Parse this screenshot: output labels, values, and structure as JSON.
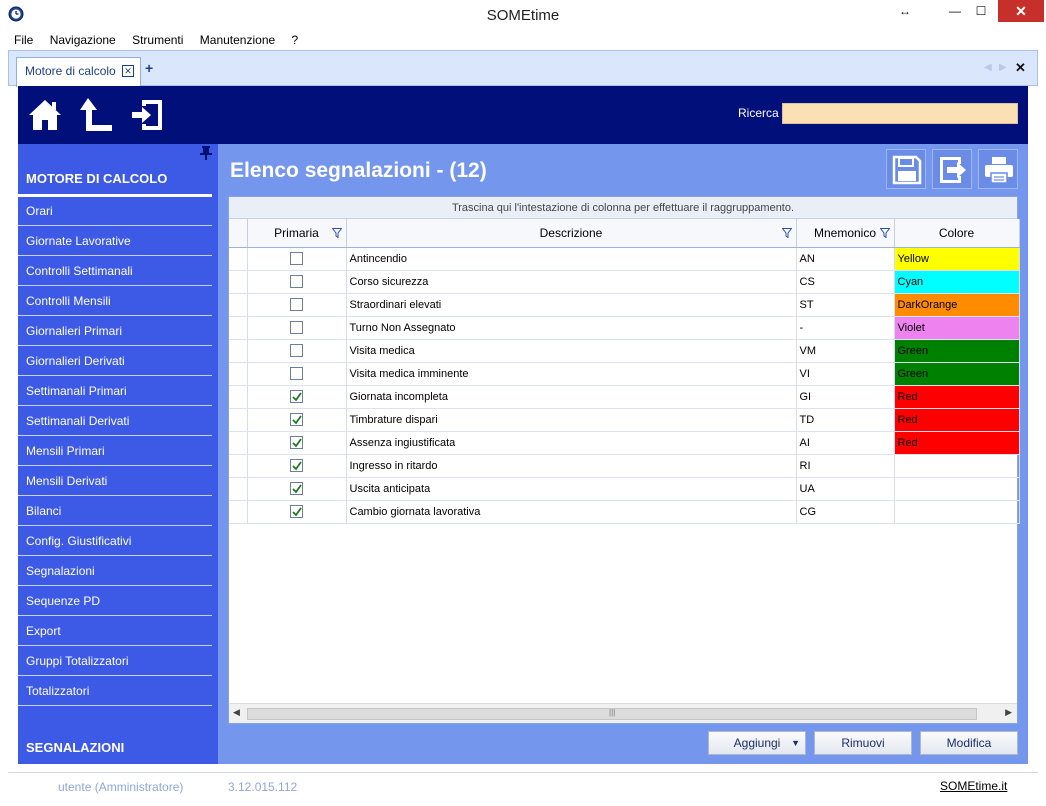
{
  "window": {
    "title": "SOMEtime"
  },
  "menu": [
    "File",
    "Navigazione",
    "Strumenti",
    "Manutenzione",
    "?"
  ],
  "tab": {
    "label": "Motore di calcolo",
    "add": "+"
  },
  "header": {
    "search_label": "Ricerca",
    "search_value": "",
    "bg_color": "#010f7b",
    "search_bg_color": "#fbe0b6"
  },
  "sidebar": {
    "title": "MOTORE DI CALCOLO",
    "items": [
      {
        "label": "Orari"
      },
      {
        "label": "Giornate Lavorative"
      },
      {
        "label": "Controlli Settimanali"
      },
      {
        "label": "Controlli Mensili"
      },
      {
        "label": "Giornalieri Primari"
      },
      {
        "label": "Giornalieri Derivati"
      },
      {
        "label": "Settimanali Primari"
      },
      {
        "label": "Settimanali Derivati"
      },
      {
        "label": "Mensili Primari"
      },
      {
        "label": "Mensili Derivati"
      },
      {
        "label": "Bilanci"
      },
      {
        "label": "Config. Giustificativi"
      },
      {
        "label": "Segnalazioni"
      },
      {
        "label": "Sequenze PD"
      },
      {
        "label": "Export"
      },
      {
        "label": "Gruppi Totalizzatori"
      },
      {
        "label": "Totalizzatori"
      }
    ],
    "footer": "SEGNALAZIONI",
    "bg_color": "#3d5ae6"
  },
  "main": {
    "title": "Elenco segnalazioni - (12)",
    "group_hint": "Trascina qui l'intestazione di colonna per effettuare il raggruppamento.",
    "columns": {
      "primaria": "Primaria",
      "descrizione": "Descrizione",
      "mnemonico": "Mnemonico",
      "colore": "Colore"
    },
    "rows": [
      {
        "primaria": false,
        "descrizione": "Antincendio",
        "mnemonico": "AN",
        "colore": "Yellow",
        "hex": "#ffff00"
      },
      {
        "primaria": false,
        "descrizione": "Corso sicurezza",
        "mnemonico": "CS",
        "colore": "Cyan",
        "hex": "#00ffff"
      },
      {
        "primaria": false,
        "descrizione": "Straordinari elevati",
        "mnemonico": "ST",
        "colore": "DarkOrange",
        "hex": "#ff8c00"
      },
      {
        "primaria": false,
        "descrizione": "Turno Non Assegnato",
        "mnemonico": "-",
        "colore": "Violet",
        "hex": "#ee82ee"
      },
      {
        "primaria": false,
        "descrizione": "Visita medica",
        "mnemonico": "VM",
        "colore": "Green",
        "hex": "#008000"
      },
      {
        "primaria": false,
        "descrizione": "Visita medica imminente",
        "mnemonico": "VI",
        "colore": "Green",
        "hex": "#008000"
      },
      {
        "primaria": true,
        "descrizione": "Giornata incompleta",
        "mnemonico": "GI",
        "colore": "Red",
        "hex": "#ff0000"
      },
      {
        "primaria": true,
        "descrizione": "Timbrature dispari",
        "mnemonico": "TD",
        "colore": "Red",
        "hex": "#ff0000"
      },
      {
        "primaria": true,
        "descrizione": "Assenza ingiustificata",
        "mnemonico": "AI",
        "colore": "Red",
        "hex": "#ff0000"
      },
      {
        "primaria": true,
        "descrizione": "Ingresso in ritardo",
        "mnemonico": "RI",
        "colore": "",
        "hex": ""
      },
      {
        "primaria": true,
        "descrizione": "Uscita anticipata",
        "mnemonico": "UA",
        "colore": "",
        "hex": ""
      },
      {
        "primaria": true,
        "descrizione": "Cambio giornata lavorativa",
        "mnemonico": "CG",
        "colore": "",
        "hex": ""
      }
    ],
    "buttons": {
      "aggiungi": "Aggiungi",
      "rimuovi": "Rimuovi",
      "modifica": "Modifica"
    },
    "bg_color": "#7496ec"
  },
  "status": {
    "user": "utente (Amministratore)",
    "version": "3.12.015.112",
    "link": "SOMEtime.it"
  }
}
